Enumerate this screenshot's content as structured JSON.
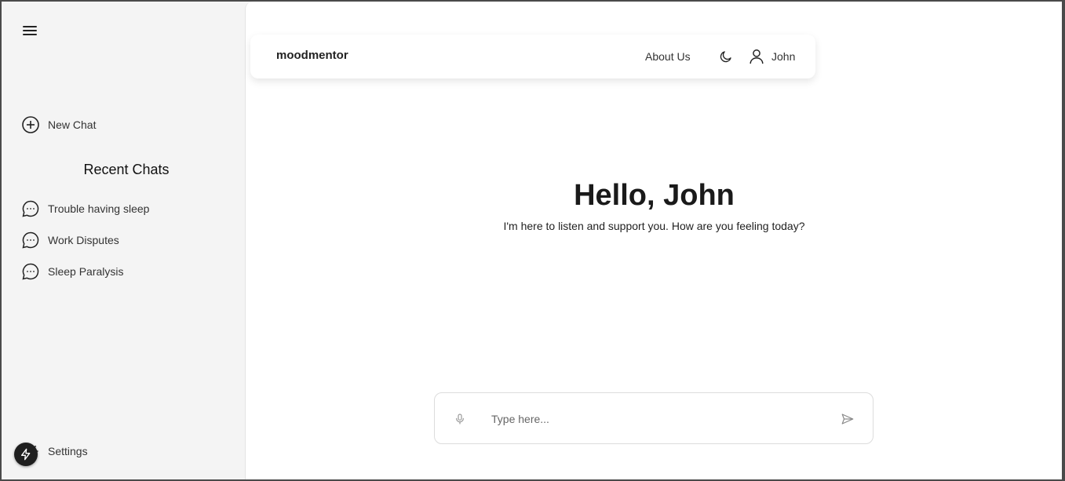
{
  "sidebar": {
    "new_chat_label": "New Chat",
    "recent_title": "Recent Chats",
    "chats": [
      {
        "label": "Trouble having sleep"
      },
      {
        "label": "Work Disputes"
      },
      {
        "label": "Sleep Paralysis"
      }
    ],
    "settings_label": "Settings"
  },
  "header": {
    "brand": "moodmentor",
    "about_label": "About Us",
    "user_name": "John"
  },
  "main": {
    "greeting": "Hello, John",
    "subtitle": "I'm here to listen and support you. How are you feeling today?"
  },
  "composer": {
    "placeholder": "Type here...",
    "value": ""
  },
  "icons": {
    "menu": "hamburger-icon",
    "new_chat": "plus-circle-icon",
    "chat": "chat-bubble-icon",
    "settings": "gear-icon",
    "badge": "bolt-icon",
    "theme": "moon-icon",
    "user": "user-icon",
    "mic": "microphone-icon",
    "send": "send-icon"
  },
  "colors": {
    "sidebar_bg": "#f4f4f4",
    "main_bg": "#ffffff",
    "text": "#1f1f1f",
    "badge_bg": "#1f1f1f"
  }
}
